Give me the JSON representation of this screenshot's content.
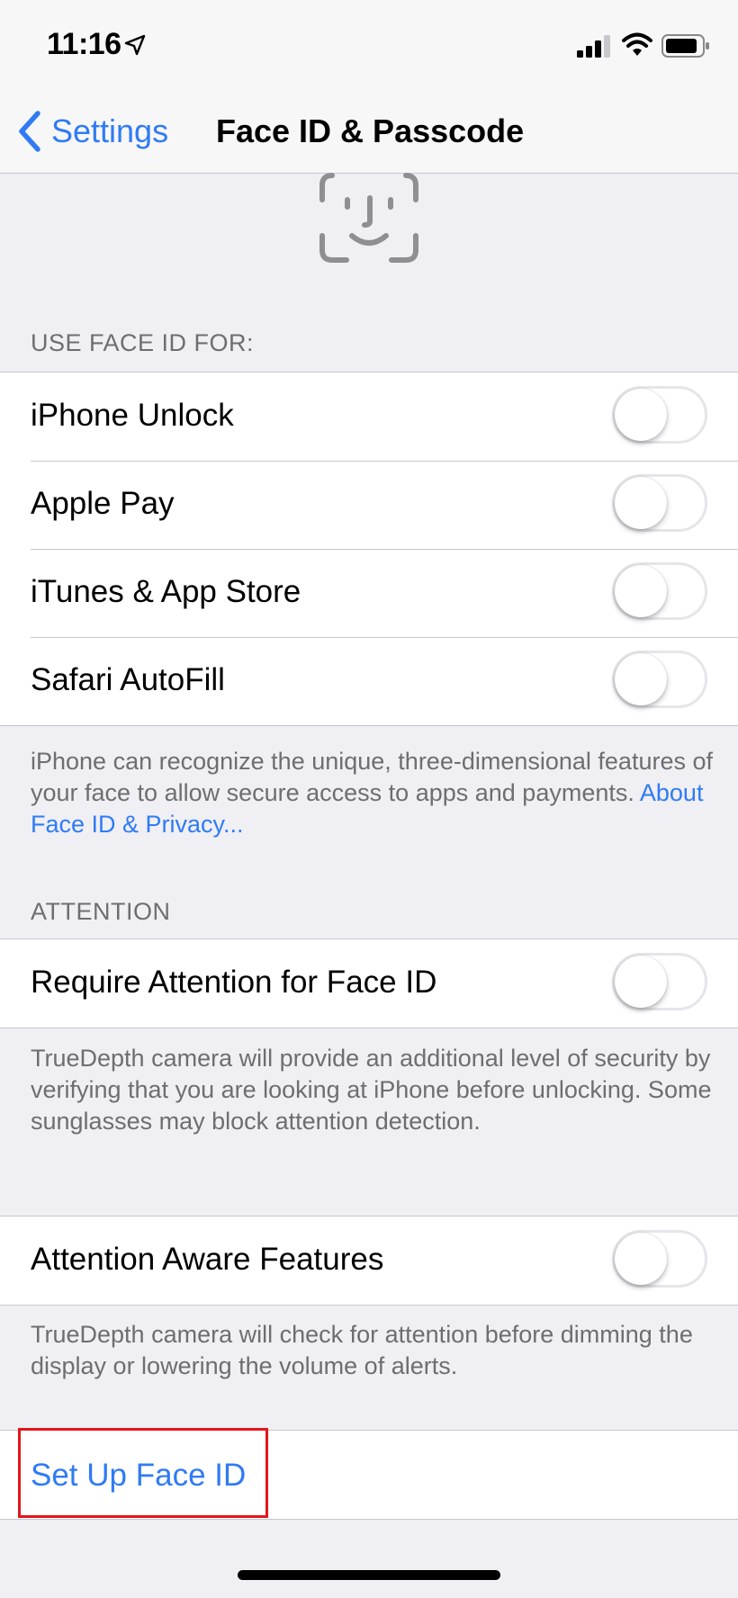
{
  "status_bar": {
    "time": "11:16",
    "location_icon": "location-arrow-icon",
    "signal_icon": "cellular-signal-icon",
    "wifi_icon": "wifi-icon",
    "battery_icon": "battery-icon"
  },
  "nav": {
    "back_label": "Settings",
    "title": "Face ID & Passcode"
  },
  "header_icon": "face-id-icon",
  "use_face_id": {
    "header": "USE FACE ID FOR:",
    "rows": [
      {
        "label": "iPhone Unlock",
        "on": false
      },
      {
        "label": "Apple Pay",
        "on": false
      },
      {
        "label": "iTunes & App Store",
        "on": false
      },
      {
        "label": "Safari AutoFill",
        "on": false
      }
    ],
    "footer": "iPhone can recognize the unique, three-dimensional features of your face to allow secure access to apps and payments.",
    "footer_link": "About Face ID & Privacy..."
  },
  "attention": {
    "header": "ATTENTION",
    "require_label": "Require Attention for Face ID",
    "require_on": false,
    "require_footer": "TrueDepth camera will provide an additional level of security by verifying that you are looking at iPhone before unlocking. Some sunglasses may block attention detection.",
    "aware_label": "Attention Aware Features",
    "aware_on": false,
    "aware_footer": "TrueDepth camera will check for attention before dimming the display or lowering the volume of alerts."
  },
  "setup": {
    "label": "Set Up Face ID"
  },
  "colors": {
    "accent": "#2f7bf5",
    "highlight": "#e3161a",
    "background": "#efeff4"
  }
}
